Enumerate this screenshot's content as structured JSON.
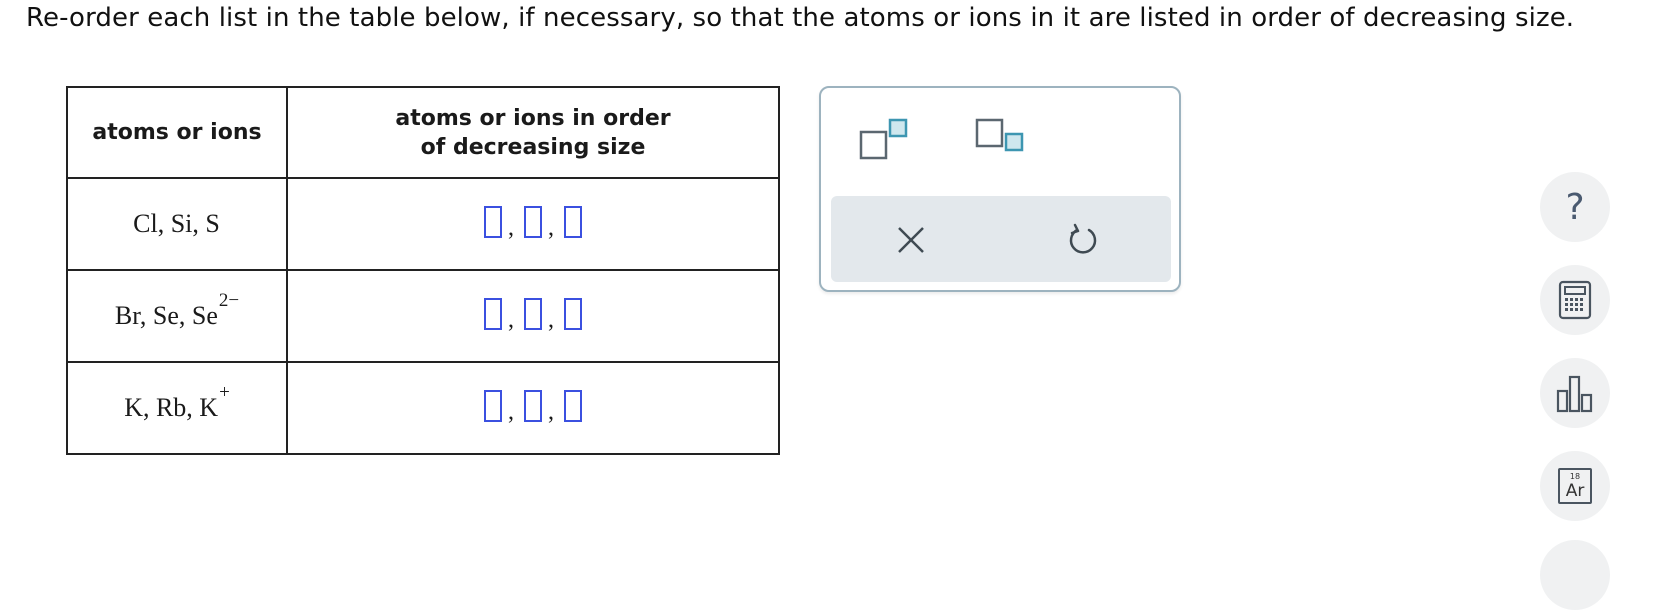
{
  "prompt": "Re-order each list in the table below, if necessary, so that the atoms or ions in it are listed in order of decreasing size.",
  "table": {
    "headers": [
      "atoms or ions",
      "atoms or ions in order of decreasing size"
    ],
    "rows": [
      {
        "base": "Cl, Si, S",
        "sup": ""
      },
      {
        "base": "Br, Se, Se",
        "sup": "2−"
      },
      {
        "base": "K, Rb, K",
        "sup": "+"
      }
    ]
  },
  "sidebar": {
    "help_label": "?",
    "periodic_number": "18",
    "periodic_symbol": "Ar"
  },
  "colors": {
    "answer_box_border": "#3b50e0",
    "toolbar_border": "#9db3bf",
    "toolbar_accent": "#3d96b1",
    "toolbar_action_bg": "#e3e8ec"
  }
}
